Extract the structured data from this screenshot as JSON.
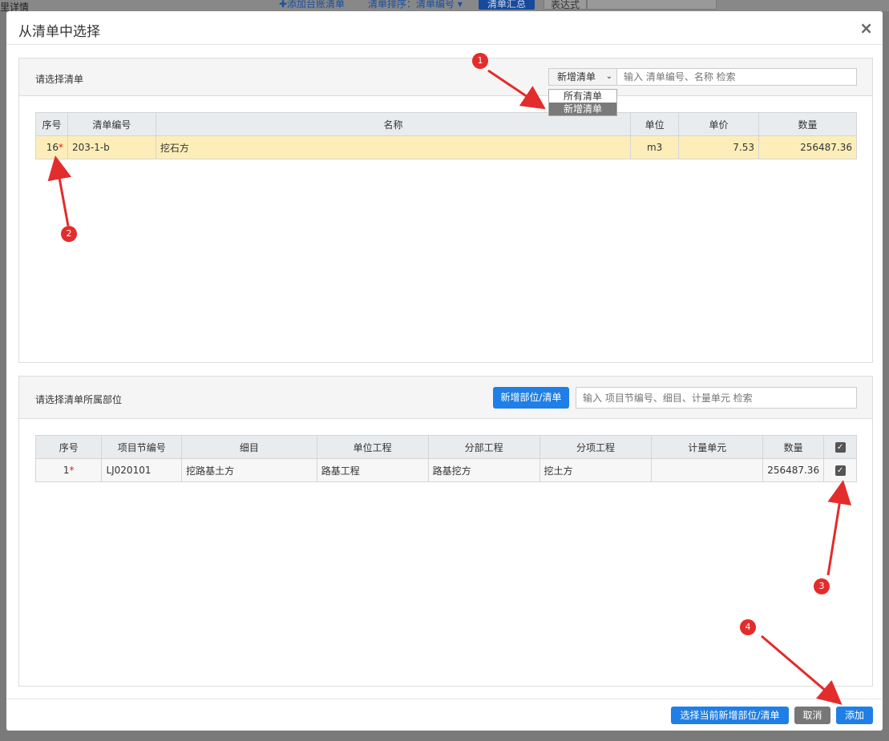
{
  "background": {
    "left_text": "里详情",
    "add_link": "✚添加台账清单",
    "sort_label": "清单排序：清单编号 ▾",
    "summary_button": "清单汇总",
    "table_button": "表达式"
  },
  "modal": {
    "title": "从清单中选择",
    "close_glyph": "×"
  },
  "list_panel": {
    "label": "请选择清单",
    "filter_selected": "新增清单",
    "filter_options": [
      "所有清单",
      "新增清单"
    ],
    "search_placeholder": "输入 清单编号、名称 检索",
    "columns": [
      "序号",
      "清单编号",
      "名称",
      "单位",
      "单价",
      "数量"
    ],
    "rows": [
      {
        "seq": "16",
        "code": "203-1-b",
        "name": "挖石方",
        "unit": "m3",
        "price": "7.53",
        "qty": "256487.36"
      }
    ]
  },
  "part_panel": {
    "label": "请选择清单所属部位",
    "new_button": "新增部位/清单",
    "search_placeholder": "输入 项目节编号、细目、计量单元 检索",
    "columns": [
      "序号",
      "项目节编号",
      "细目",
      "单位工程",
      "分部工程",
      "分项工程",
      "计量单元",
      "数量"
    ],
    "rows": [
      {
        "seq": "1",
        "code": "LJ020101",
        "item": "挖路基土方",
        "unit_project": "路基工程",
        "division": "路基挖方",
        "subitem": "挖土方",
        "measure_unit": "",
        "qty": "256487.36"
      }
    ]
  },
  "footer": {
    "select_current": "选择当前新增部位/清单",
    "cancel": "取消",
    "add": "添加"
  },
  "annotations": [
    "1",
    "2",
    "3",
    "4"
  ],
  "colors": {
    "primary": "#1f7fe6",
    "highlight_row": "#fdeeb9",
    "annotation": "#e32c2c",
    "required_star": "#e02020"
  },
  "icons": {
    "check": "check-icon",
    "close": "close-icon",
    "caret": "caret-down-icon"
  }
}
